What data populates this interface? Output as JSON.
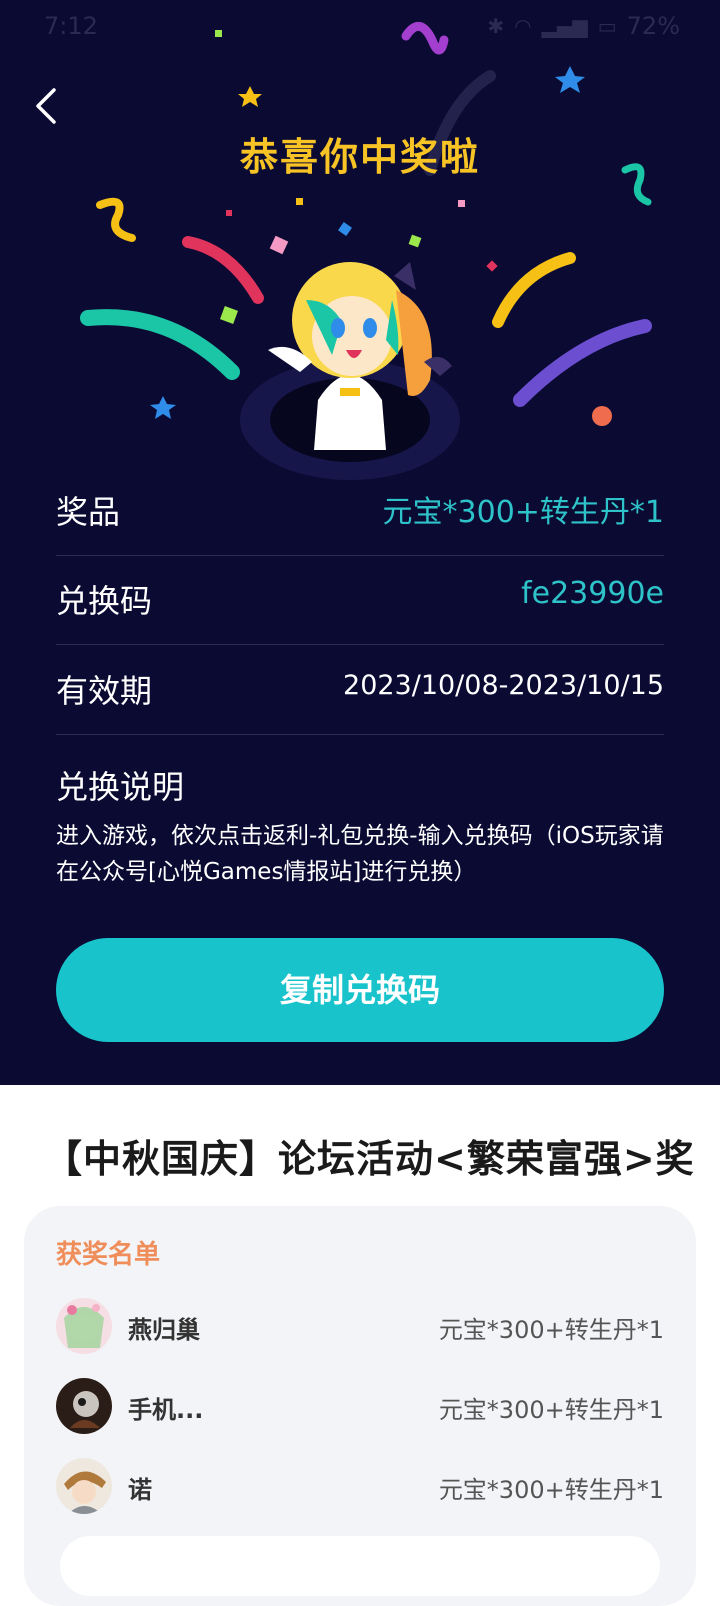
{
  "status_bar": {
    "time": "7:12",
    "battery": "72%"
  },
  "header": {
    "title": "恭喜你中奖啦"
  },
  "details": {
    "prize_label": "奖品",
    "prize_value": "元宝*300+转生丹*1",
    "code_label": "兑换码",
    "code_value": "fe23990e",
    "validity_label": "有效期",
    "validity_value": "2023/10/08-2023/10/15",
    "instructions_title": "兑换说明",
    "instructions_text": "进入游戏，依次点击返利-礼包兑换-输入兑换码（iOS玩家请在公众号[心悦Games情报站]进行兑换）"
  },
  "copy_button": {
    "label": "复制兑换码"
  },
  "event": {
    "title": "【中秋国庆】论坛活动<繁荣富强>奖"
  },
  "winners": {
    "heading": "获奖名单",
    "items": [
      {
        "name": "燕归巢",
        "prize": "元宝*300+转生丹*1"
      },
      {
        "name": "手机...",
        "prize": "元宝*300+转生丹*1"
      },
      {
        "name": "诺",
        "prize": "元宝*300+转生丹*1"
      }
    ]
  },
  "colors": {
    "background": "#0b0a33",
    "title_yellow": "#f7c325",
    "accent_teal": "#2ec3c9",
    "button_teal": "#19c3cb",
    "winners_heading": "#ef8e5a"
  }
}
